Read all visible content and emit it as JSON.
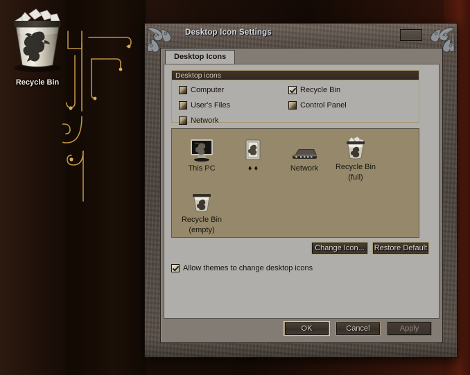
{
  "desktop": {
    "icons": [
      {
        "name": "recycle-bin",
        "label": "Recycle Bin"
      }
    ]
  },
  "window": {
    "title": "Desktop Icon Settings",
    "close_label": "",
    "corner_ornament": "dragon-ornament"
  },
  "tabs": [
    {
      "id": "desktop-icons",
      "label": "Desktop Icons",
      "selected": true
    }
  ],
  "group": {
    "title": "Desktop icons",
    "checkboxes": [
      {
        "label": "Computer",
        "checked": false
      },
      {
        "label": "User's Files",
        "checked": false
      },
      {
        "label": "Network",
        "checked": false
      },
      {
        "label": "Recycle Bin",
        "checked": true
      },
      {
        "label": "Control Panel",
        "checked": false
      }
    ]
  },
  "preview": {
    "items": [
      {
        "icon": "this-pc-icon",
        "label": "This PC",
        "sublabel": ""
      },
      {
        "icon": "users-files-icon",
        "label": "♦ ♦",
        "sublabel": ""
      },
      {
        "icon": "network-icon",
        "label": "Network",
        "sublabel": ""
      },
      {
        "icon": "recycle-bin-full-icon",
        "label": "Recycle Bin",
        "sublabel": "(full)"
      },
      {
        "icon": "recycle-bin-empty-icon",
        "label": "Recycle Bin",
        "sublabel": "(empty)"
      }
    ]
  },
  "buttons": {
    "change_icon": "Change Icon...",
    "restore_default": "Restore Default",
    "ok": "OK",
    "cancel": "Cancel",
    "apply": "Apply"
  },
  "options": {
    "allow_themes": {
      "label": "Allow themes to change desktop icons",
      "checked": true
    }
  },
  "colors": {
    "desktop_bg": "#1a0f0a",
    "filigree_gold": "#c79a48",
    "frame_stone": "#564c45",
    "dialog_bg": "#827c75",
    "tab_panel": "#b0aeaa",
    "preview_bg": "#95886b",
    "button_border_gold": "#a8996f",
    "title_text": "#cfd6de"
  }
}
